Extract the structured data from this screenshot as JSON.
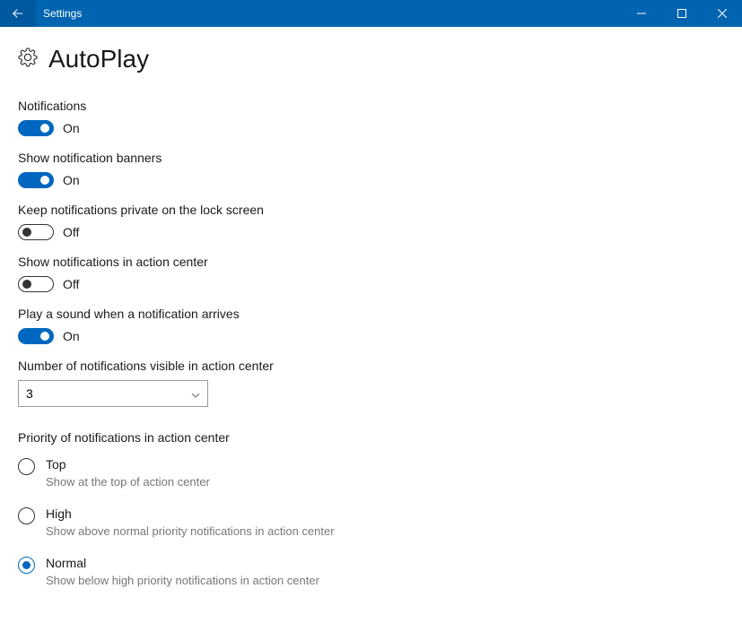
{
  "window": {
    "title": "Settings"
  },
  "header": {
    "title": "AutoPlay"
  },
  "toggles": {
    "notifications": {
      "label": "Notifications",
      "state": "On",
      "on": true
    },
    "banners": {
      "label": "Show notification banners",
      "state": "On",
      "on": true
    },
    "private_lock": {
      "label": "Keep notifications private on the lock screen",
      "state": "Off",
      "on": false
    },
    "action_center": {
      "label": "Show notifications in action center",
      "state": "Off",
      "on": false
    },
    "sound": {
      "label": "Play a sound when a notification arrives",
      "state": "On",
      "on": true
    }
  },
  "select": {
    "label": "Number of notifications visible in action center",
    "value": "3"
  },
  "priority": {
    "heading": "Priority of notifications in action center",
    "options": {
      "top": {
        "label": "Top",
        "desc": "Show at the top of action center",
        "selected": false
      },
      "high": {
        "label": "High",
        "desc": "Show above normal priority notifications in action center",
        "selected": false
      },
      "normal": {
        "label": "Normal",
        "desc": "Show below high priority notifications in action center",
        "selected": true
      }
    }
  }
}
